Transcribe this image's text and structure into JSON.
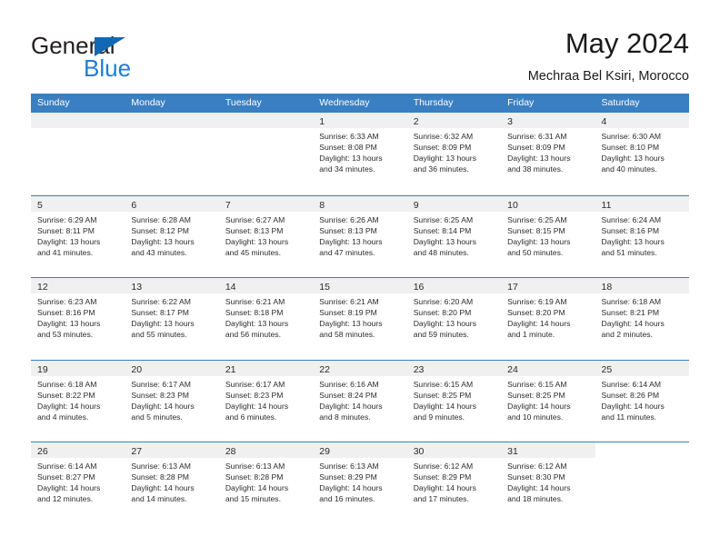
{
  "brand": {
    "name_part1": "General",
    "name_part2": "Blue",
    "logo_icon": "blue-triangle-icon"
  },
  "header": {
    "title": "May 2024",
    "location": "Mechraa Bel Ksiri, Morocco"
  },
  "colors": {
    "header_blue": "#3a7fc1",
    "brand_blue": "#1b7fd4",
    "logo_blue": "#1268b3",
    "day_number_band": "#f0f0f0",
    "text": "#2b2b2b"
  },
  "weekdays": [
    "Sunday",
    "Monday",
    "Tuesday",
    "Wednesday",
    "Thursday",
    "Friday",
    "Saturday"
  ],
  "weeks": [
    [
      {
        "day": "",
        "sunrise": "",
        "sunset": "",
        "daylight1": "",
        "daylight2": "",
        "state": "empty"
      },
      {
        "day": "",
        "sunrise": "",
        "sunset": "",
        "daylight1": "",
        "daylight2": "",
        "state": "empty"
      },
      {
        "day": "",
        "sunrise": "",
        "sunset": "",
        "daylight1": "",
        "daylight2": "",
        "state": "empty"
      },
      {
        "day": "1",
        "sunrise": "Sunrise: 6:33 AM",
        "sunset": "Sunset: 8:08 PM",
        "daylight1": "Daylight: 13 hours",
        "daylight2": "and 34 minutes.",
        "state": "filled"
      },
      {
        "day": "2",
        "sunrise": "Sunrise: 6:32 AM",
        "sunset": "Sunset: 8:09 PM",
        "daylight1": "Daylight: 13 hours",
        "daylight2": "and 36 minutes.",
        "state": "filled"
      },
      {
        "day": "3",
        "sunrise": "Sunrise: 6:31 AM",
        "sunset": "Sunset: 8:09 PM",
        "daylight1": "Daylight: 13 hours",
        "daylight2": "and 38 minutes.",
        "state": "filled"
      },
      {
        "day": "4",
        "sunrise": "Sunrise: 6:30 AM",
        "sunset": "Sunset: 8:10 PM",
        "daylight1": "Daylight: 13 hours",
        "daylight2": "and 40 minutes.",
        "state": "filled"
      }
    ],
    [
      {
        "day": "5",
        "sunrise": "Sunrise: 6:29 AM",
        "sunset": "Sunset: 8:11 PM",
        "daylight1": "Daylight: 13 hours",
        "daylight2": "and 41 minutes.",
        "state": "filled"
      },
      {
        "day": "6",
        "sunrise": "Sunrise: 6:28 AM",
        "sunset": "Sunset: 8:12 PM",
        "daylight1": "Daylight: 13 hours",
        "daylight2": "and 43 minutes.",
        "state": "filled"
      },
      {
        "day": "7",
        "sunrise": "Sunrise: 6:27 AM",
        "sunset": "Sunset: 8:13 PM",
        "daylight1": "Daylight: 13 hours",
        "daylight2": "and 45 minutes.",
        "state": "filled"
      },
      {
        "day": "8",
        "sunrise": "Sunrise: 6:26 AM",
        "sunset": "Sunset: 8:13 PM",
        "daylight1": "Daylight: 13 hours",
        "daylight2": "and 47 minutes.",
        "state": "filled"
      },
      {
        "day": "9",
        "sunrise": "Sunrise: 6:25 AM",
        "sunset": "Sunset: 8:14 PM",
        "daylight1": "Daylight: 13 hours",
        "daylight2": "and 48 minutes.",
        "state": "filled"
      },
      {
        "day": "10",
        "sunrise": "Sunrise: 6:25 AM",
        "sunset": "Sunset: 8:15 PM",
        "daylight1": "Daylight: 13 hours",
        "daylight2": "and 50 minutes.",
        "state": "filled"
      },
      {
        "day": "11",
        "sunrise": "Sunrise: 6:24 AM",
        "sunset": "Sunset: 8:16 PM",
        "daylight1": "Daylight: 13 hours",
        "daylight2": "and 51 minutes.",
        "state": "filled"
      }
    ],
    [
      {
        "day": "12",
        "sunrise": "Sunrise: 6:23 AM",
        "sunset": "Sunset: 8:16 PM",
        "daylight1": "Daylight: 13 hours",
        "daylight2": "and 53 minutes.",
        "state": "filled"
      },
      {
        "day": "13",
        "sunrise": "Sunrise: 6:22 AM",
        "sunset": "Sunset: 8:17 PM",
        "daylight1": "Daylight: 13 hours",
        "daylight2": "and 55 minutes.",
        "state": "filled"
      },
      {
        "day": "14",
        "sunrise": "Sunrise: 6:21 AM",
        "sunset": "Sunset: 8:18 PM",
        "daylight1": "Daylight: 13 hours",
        "daylight2": "and 56 minutes.",
        "state": "filled"
      },
      {
        "day": "15",
        "sunrise": "Sunrise: 6:21 AM",
        "sunset": "Sunset: 8:19 PM",
        "daylight1": "Daylight: 13 hours",
        "daylight2": "and 58 minutes.",
        "state": "filled"
      },
      {
        "day": "16",
        "sunrise": "Sunrise: 6:20 AM",
        "sunset": "Sunset: 8:20 PM",
        "daylight1": "Daylight: 13 hours",
        "daylight2": "and 59 minutes.",
        "state": "filled"
      },
      {
        "day": "17",
        "sunrise": "Sunrise: 6:19 AM",
        "sunset": "Sunset: 8:20 PM",
        "daylight1": "Daylight: 14 hours",
        "daylight2": "and 1 minute.",
        "state": "filled"
      },
      {
        "day": "18",
        "sunrise": "Sunrise: 6:18 AM",
        "sunset": "Sunset: 8:21 PM",
        "daylight1": "Daylight: 14 hours",
        "daylight2": "and 2 minutes.",
        "state": "filled"
      }
    ],
    [
      {
        "day": "19",
        "sunrise": "Sunrise: 6:18 AM",
        "sunset": "Sunset: 8:22 PM",
        "daylight1": "Daylight: 14 hours",
        "daylight2": "and 4 minutes.",
        "state": "filled"
      },
      {
        "day": "20",
        "sunrise": "Sunrise: 6:17 AM",
        "sunset": "Sunset: 8:23 PM",
        "daylight1": "Daylight: 14 hours",
        "daylight2": "and 5 minutes.",
        "state": "filled"
      },
      {
        "day": "21",
        "sunrise": "Sunrise: 6:17 AM",
        "sunset": "Sunset: 8:23 PM",
        "daylight1": "Daylight: 14 hours",
        "daylight2": "and 6 minutes.",
        "state": "filled"
      },
      {
        "day": "22",
        "sunrise": "Sunrise: 6:16 AM",
        "sunset": "Sunset: 8:24 PM",
        "daylight1": "Daylight: 14 hours",
        "daylight2": "and 8 minutes.",
        "state": "filled"
      },
      {
        "day": "23",
        "sunrise": "Sunrise: 6:15 AM",
        "sunset": "Sunset: 8:25 PM",
        "daylight1": "Daylight: 14 hours",
        "daylight2": "and 9 minutes.",
        "state": "filled"
      },
      {
        "day": "24",
        "sunrise": "Sunrise: 6:15 AM",
        "sunset": "Sunset: 8:25 PM",
        "daylight1": "Daylight: 14 hours",
        "daylight2": "and 10 minutes.",
        "state": "filled"
      },
      {
        "day": "25",
        "sunrise": "Sunrise: 6:14 AM",
        "sunset": "Sunset: 8:26 PM",
        "daylight1": "Daylight: 14 hours",
        "daylight2": "and 11 minutes.",
        "state": "filled"
      }
    ],
    [
      {
        "day": "26",
        "sunrise": "Sunrise: 6:14 AM",
        "sunset": "Sunset: 8:27 PM",
        "daylight1": "Daylight: 14 hours",
        "daylight2": "and 12 minutes.",
        "state": "filled"
      },
      {
        "day": "27",
        "sunrise": "Sunrise: 6:13 AM",
        "sunset": "Sunset: 8:28 PM",
        "daylight1": "Daylight: 14 hours",
        "daylight2": "and 14 minutes.",
        "state": "filled"
      },
      {
        "day": "28",
        "sunrise": "Sunrise: 6:13 AM",
        "sunset": "Sunset: 8:28 PM",
        "daylight1": "Daylight: 14 hours",
        "daylight2": "and 15 minutes.",
        "state": "filled"
      },
      {
        "day": "29",
        "sunrise": "Sunrise: 6:13 AM",
        "sunset": "Sunset: 8:29 PM",
        "daylight1": "Daylight: 14 hours",
        "daylight2": "and 16 minutes.",
        "state": "filled"
      },
      {
        "day": "30",
        "sunrise": "Sunrise: 6:12 AM",
        "sunset": "Sunset: 8:29 PM",
        "daylight1": "Daylight: 14 hours",
        "daylight2": "and 17 minutes.",
        "state": "filled"
      },
      {
        "day": "31",
        "sunrise": "Sunrise: 6:12 AM",
        "sunset": "Sunset: 8:30 PM",
        "daylight1": "Daylight: 14 hours",
        "daylight2": "and 18 minutes.",
        "state": "filled"
      },
      {
        "day": "",
        "sunrise": "",
        "sunset": "",
        "daylight1": "",
        "daylight2": "",
        "state": "blank"
      }
    ]
  ]
}
